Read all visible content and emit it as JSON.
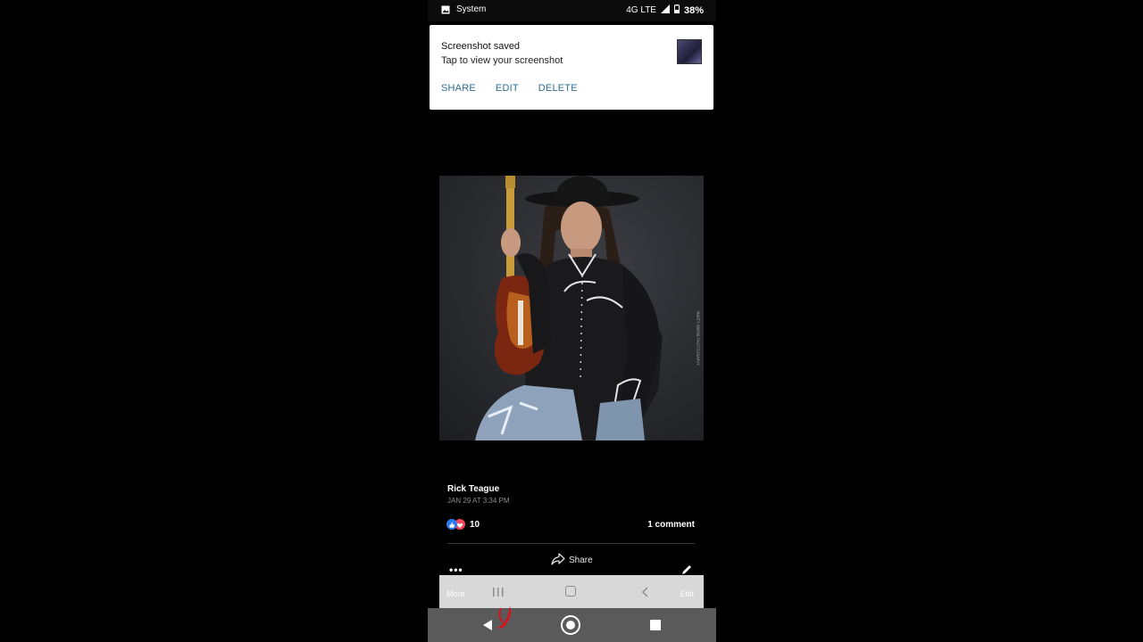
{
  "status_bar": {
    "app_label": "System",
    "network": "4G LTE",
    "battery_percent": "38%",
    "icons": [
      "image-icon",
      "signal-icon",
      "battery-icon"
    ]
  },
  "notification": {
    "title": "Screenshot saved",
    "subtitle": "Tap to view your screenshot",
    "actions": [
      "SHARE",
      "EDIT",
      "DELETE"
    ]
  },
  "photo": {
    "watermark": "MARTY WAYNE PHOTOGRAPHY"
  },
  "post": {
    "author": "Rick Teague",
    "timestamp": "JAN 29 AT 3:34 PM",
    "reaction_count": "10",
    "comment_count": "1 comment",
    "share_label": "Share",
    "more_dots": "•••"
  },
  "inner_nav": {
    "more_label": "More",
    "edit_label": "Edit"
  },
  "colors": {
    "notification_action": "#2f6c8f",
    "like": "#2c7bf0",
    "love": "#f0475d"
  }
}
